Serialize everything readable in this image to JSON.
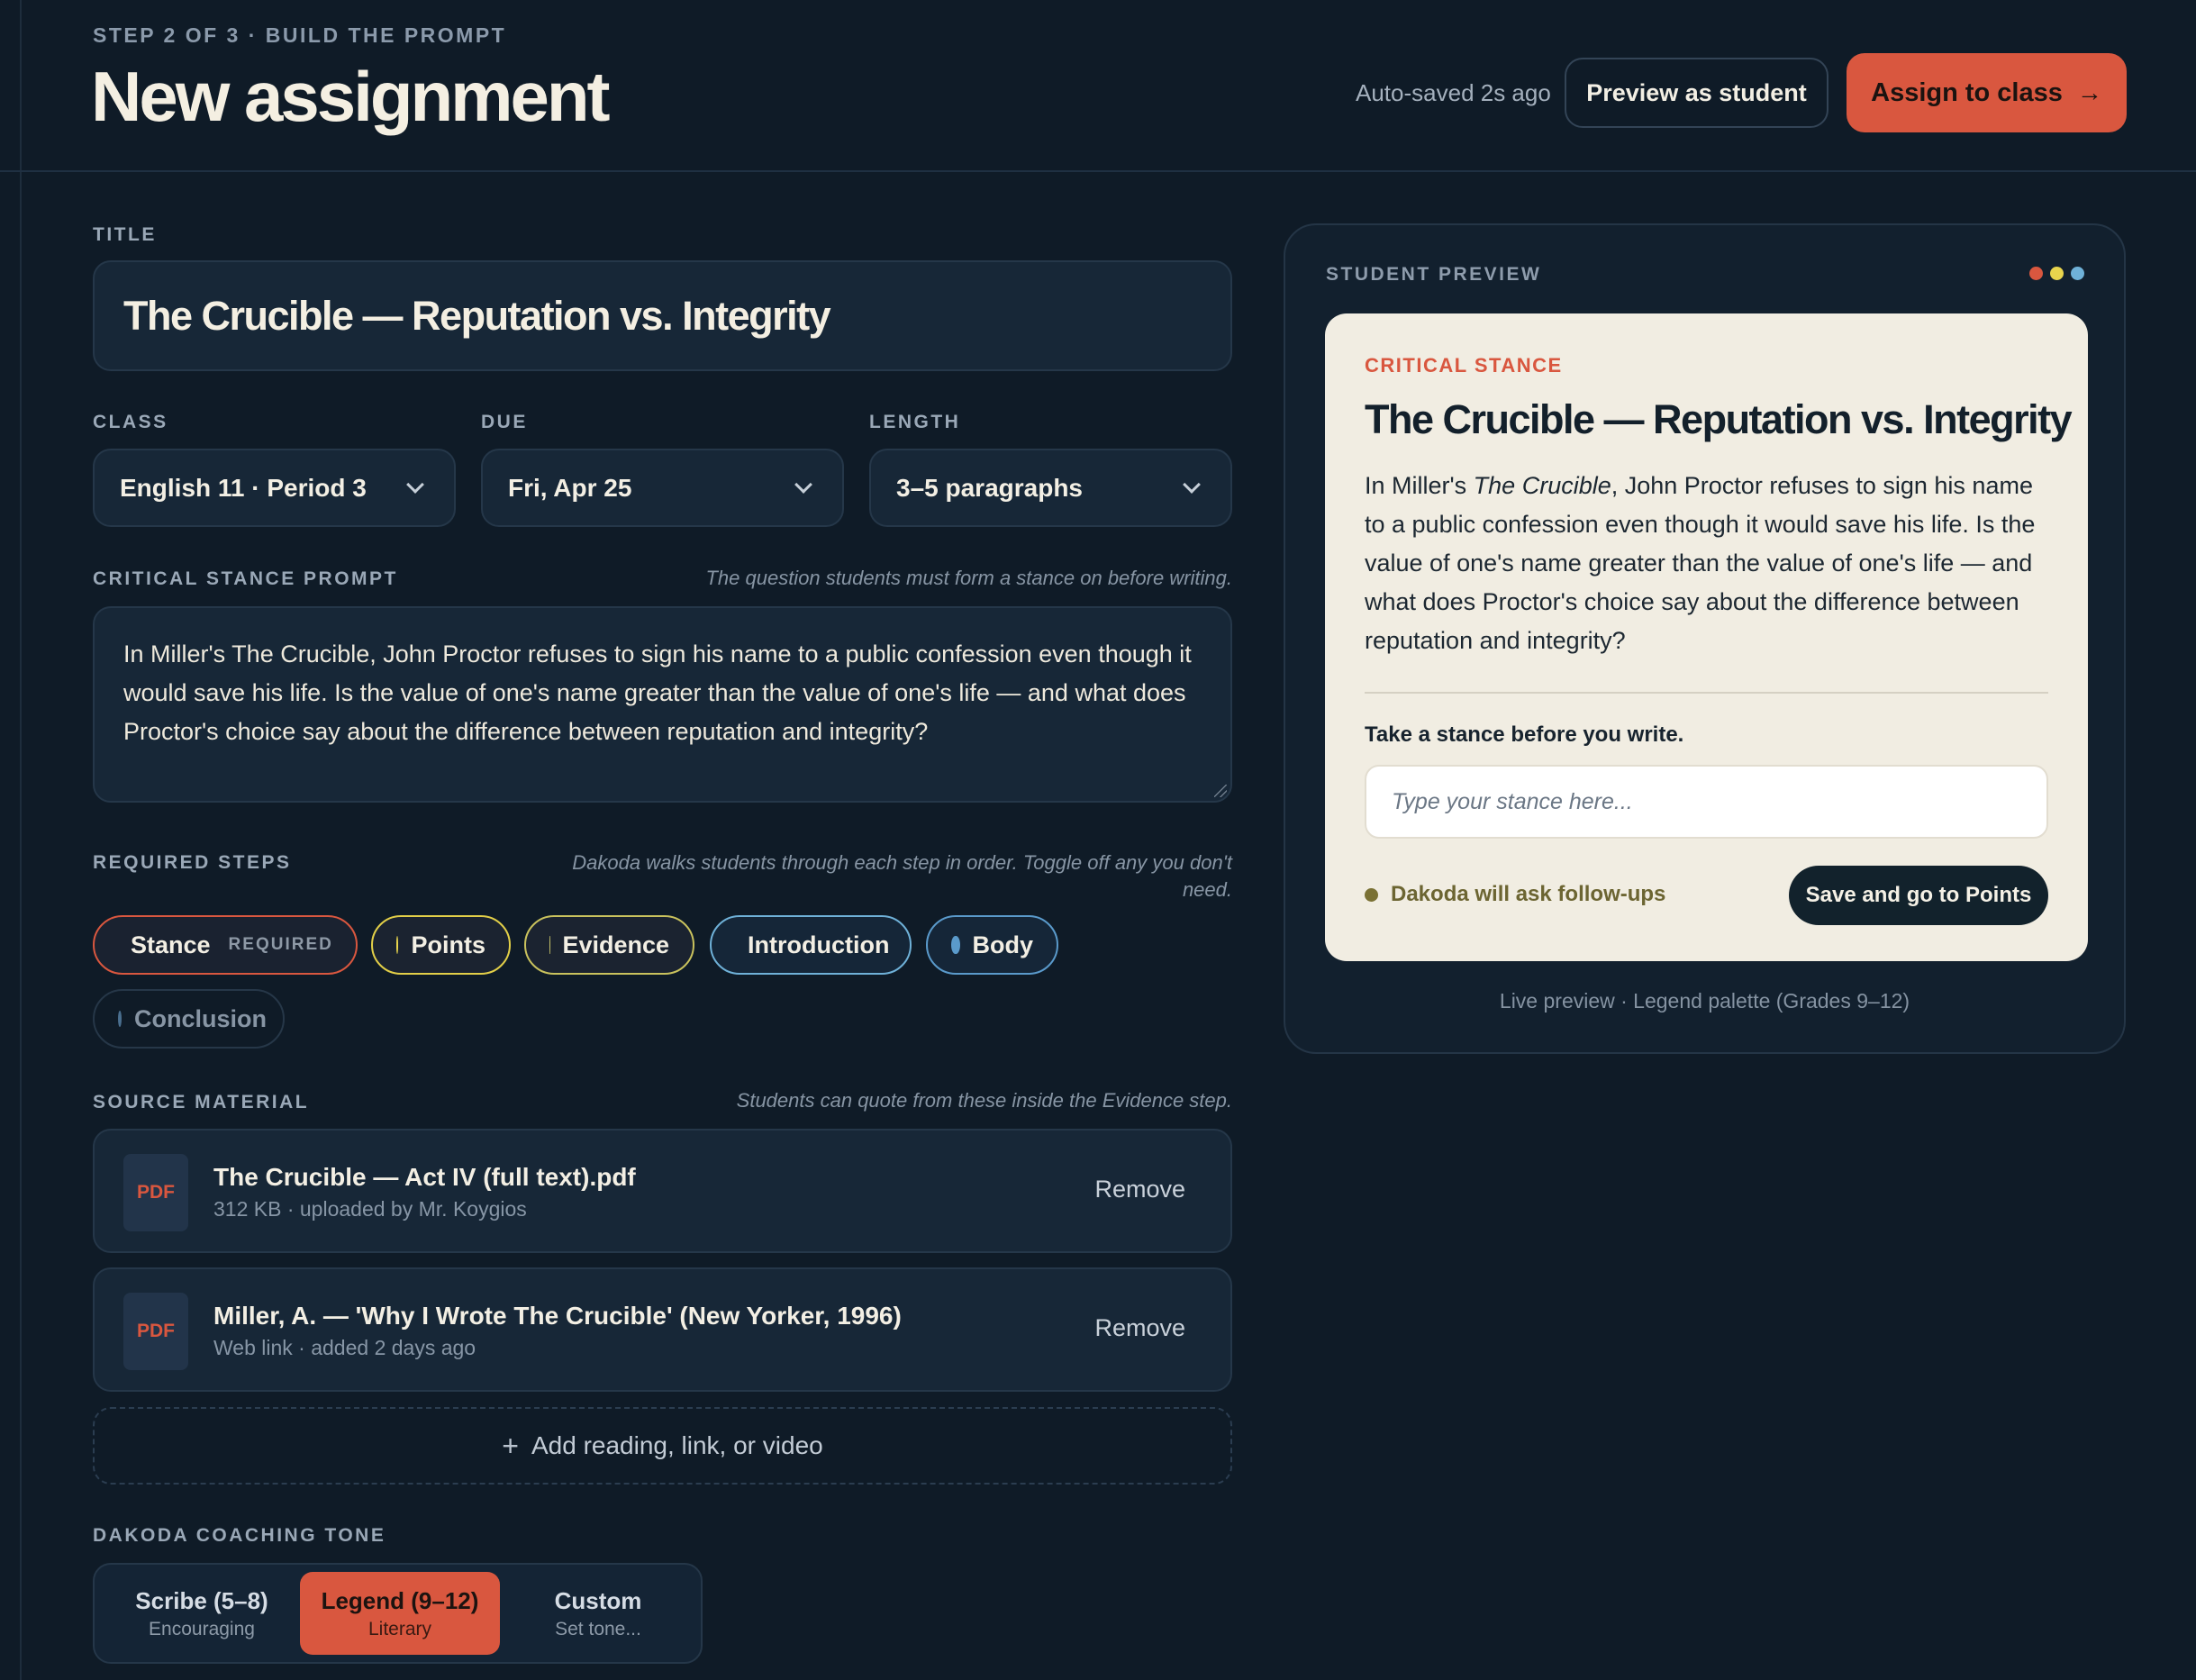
{
  "header": {
    "step": "STEP 2 OF 3 · BUILD THE PROMPT",
    "title": "New assignment",
    "autosave": "Auto-saved 2s ago",
    "preview_btn": "Preview as student",
    "assign_btn": "Assign to class",
    "assign_icon": "arrow-right-icon"
  },
  "form": {
    "title_label": "TITLE",
    "title_value": "The Crucible — Reputation vs. Integrity",
    "class_label": "CLASS",
    "class_value": "English 11 · Period 3",
    "due_label": "DUE",
    "due_value": "Fri, Apr 25",
    "length_label": "LENGTH",
    "length_value": "3–5 paragraphs",
    "prompt_label": "CRITICAL STANCE PROMPT",
    "prompt_hint": "The question students must form a stance on before writing.",
    "prompt_value": "In Miller's The Crucible, John Proctor refuses to sign his name to a public confession even though it would save his life. Is the value of one's name greater than the value of one's life — and what does Proctor's choice say about the difference between reputation and integrity?"
  },
  "steps": {
    "label": "REQUIRED STEPS",
    "hint": "Dakoda walks students through each step in order. Toggle off any you don't need.",
    "items": [
      {
        "label": "Stance",
        "tag": "REQUIRED",
        "color": "#d9573f"
      },
      {
        "label": "Points",
        "color": "#e8d44d"
      },
      {
        "label": "Evidence",
        "color": "#c8c46a"
      },
      {
        "label": "Introduction",
        "color": "#6fb1d8"
      },
      {
        "label": "Body",
        "color": "#5a9acb"
      },
      {
        "label": "Conclusion",
        "color": "#4a6f8f"
      }
    ]
  },
  "sources": {
    "label": "SOURCE MATERIAL",
    "hint": "Students can quote from these inside the Evidence step.",
    "items": [
      {
        "icon": "PDF",
        "name": "The Crucible — Act IV (full text).pdf",
        "meta": "312 KB · uploaded by Mr. Koygios",
        "action": "Remove"
      },
      {
        "icon": "PDF",
        "name": "Miller, A. — 'Why I Wrote The Crucible' (New Yorker, 1996)",
        "meta": "Web link · added 2 days ago",
        "action": "Remove"
      }
    ],
    "add_label": "Add reading, link, or video"
  },
  "tone": {
    "label": "DAKODA COACHING TONE",
    "options": [
      {
        "title": "Scribe (5–8)",
        "sub": "Encouraging"
      },
      {
        "title": "Legend (9–12)",
        "sub": "Literary"
      },
      {
        "title": "Custom",
        "sub": "Set tone..."
      }
    ]
  },
  "preview": {
    "label": "STUDENT PREVIEW",
    "kicker": "CRITICAL STANCE",
    "title": "The Crucible — Reputation vs. Integrity",
    "body_pre": "In Miller's ",
    "body_em": "The Crucible",
    "body_post": ", John Proctor refuses to sign his name to a public confession even though it would save his life. Is the value of one's name greater than the value of one's life — and what does Proctor's choice say about the difference between reputation and integrity?",
    "question": "Take a stance before you write.",
    "input_placeholder": "Type your stance here...",
    "follow": "Dakoda will ask follow-ups",
    "save_btn": "Save and go to Points",
    "caption": "Live preview · Legend palette (Grades 9–12)"
  },
  "colors": {
    "accent": "#d9573f",
    "background": "#0f1b27",
    "card": "#f1ede2"
  }
}
